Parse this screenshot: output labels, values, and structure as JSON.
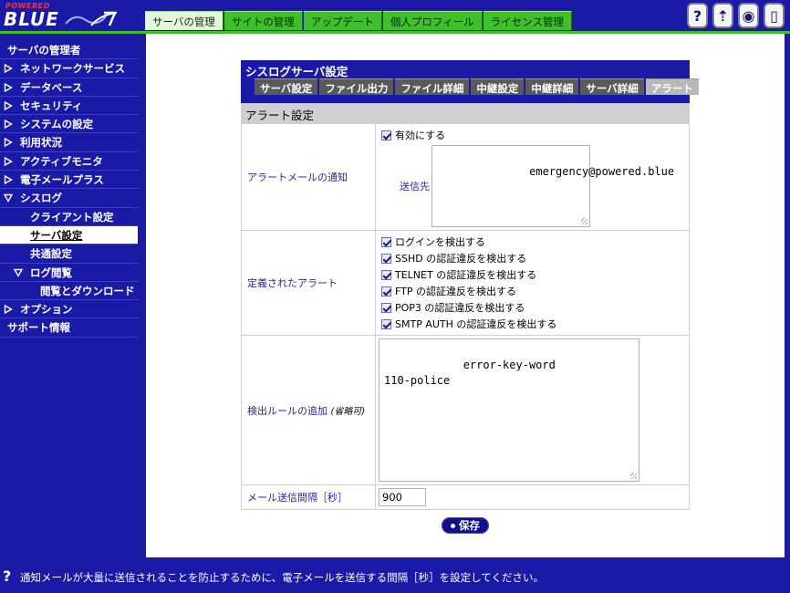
{
  "header": {
    "logo_powered": "POWERED",
    "logo_blue": "BLUE",
    "top_tabs": [
      "サーバの管理",
      "サイトの管理",
      "アップデート",
      "個人プロフィール",
      "ライセンス管理"
    ],
    "active_tab": "サーバの管理",
    "actions": [
      {
        "icon": "help-icon",
        "glyph": "?"
      },
      {
        "icon": "upload-icon",
        "glyph": "⇡"
      },
      {
        "icon": "eye-icon",
        "glyph": "◉"
      },
      {
        "icon": "logout-icon",
        "glyph": "▯"
      }
    ]
  },
  "sidebar": {
    "items": [
      {
        "label": "サーバの管理者",
        "icon": "none"
      },
      {
        "label": "ネットワークサービス",
        "icon": "expand-right"
      },
      {
        "label": "データベース",
        "icon": "expand-right"
      },
      {
        "label": "セキュリティ",
        "icon": "expand-right"
      },
      {
        "label": "システムの設定",
        "icon": "expand-right"
      },
      {
        "label": "利用状況",
        "icon": "expand-right"
      },
      {
        "label": "アクティブモニタ",
        "icon": "expand-right"
      },
      {
        "label": "電子メールプラス",
        "icon": "expand-right"
      },
      {
        "label": "シスログ",
        "icon": "expand-down"
      },
      {
        "label": "クライアント設定",
        "icon": "none",
        "level": 1
      },
      {
        "label": "サーバ設定",
        "icon": "none",
        "level": 1,
        "selected": true
      },
      {
        "label": "共通設定",
        "icon": "none",
        "level": 1
      },
      {
        "label": "ログ閲覧",
        "icon": "expand-down",
        "level": 1
      },
      {
        "label": "閲覧とダウンロード",
        "icon": "none",
        "level": 2
      },
      {
        "label": "オプション",
        "icon": "expand-right"
      },
      {
        "label": "サポート情報",
        "icon": "none"
      }
    ]
  },
  "panel": {
    "title": "シスログサーバ設定",
    "tabs": [
      "サーバ設定",
      "ファイル出力",
      "ファイル詳細",
      "中継設定",
      "中継詳細",
      "サーバ詳細",
      "アラート"
    ],
    "active_tab": "アラート",
    "section_title": "アラート設定",
    "alert_mail": {
      "label": "アラートメールの通知",
      "enable_label": "有効にする",
      "enabled": true,
      "dest_label": "送信先",
      "dest_value": "emergency@powered.blue"
    },
    "defined_alerts": {
      "label": "定義されたアラート",
      "items": [
        "ログインを検出する",
        "SSHD の認証違反を検出する",
        "TELNET の認証違反を検出する",
        "FTP の認証違反を検出する",
        "POP3 の認証違反を検出する",
        "SMTP AUTH の認証違反を検出する"
      ]
    },
    "detect_rule": {
      "label": "検出ルールの追加",
      "label_note": "(省略可)",
      "value": "error-key-word\n110-police"
    },
    "mail_interval": {
      "label": "メール送信間隔［秒］",
      "value": "900"
    },
    "save_label": "保存"
  },
  "footer": {
    "help_glyph": "?",
    "message": "通知メールが大量に送信されることを防止するために、電子メールを送信する間隔［秒］を設定してください。"
  },
  "colors": {
    "navy": "#1a1aa6",
    "green": "#3fbf2a",
    "label_blue": "#27279c"
  }
}
